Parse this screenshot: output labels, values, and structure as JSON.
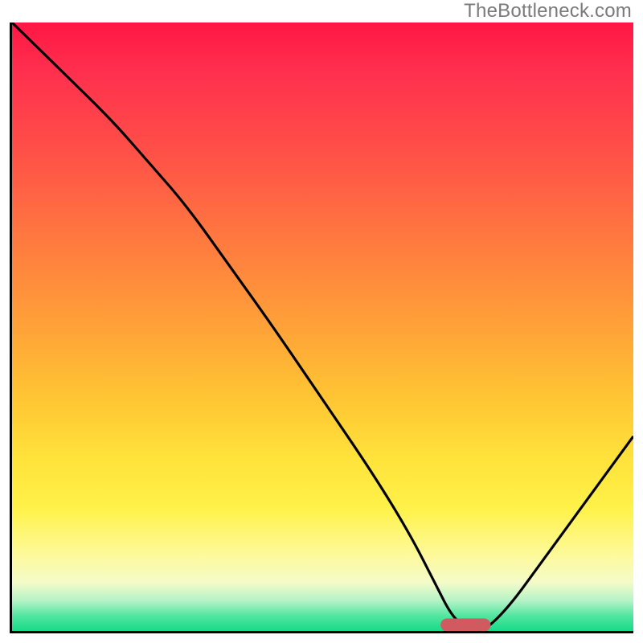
{
  "watermark": "TheBottleneck.com",
  "colors": {
    "axis": "#000000",
    "curve": "#000000",
    "marker": "#d05a5f",
    "gradient_top": "#ff1744",
    "gradient_bottom": "#18da87"
  },
  "chart_data": {
    "type": "line",
    "title": "",
    "xlabel": "",
    "ylabel": "",
    "xlim": [
      0,
      100
    ],
    "ylim": [
      0,
      100
    ],
    "grid": false,
    "legend": false,
    "annotations": [
      "TheBottleneck.com"
    ],
    "marker": {
      "x_start": 70,
      "x_end": 76,
      "y": 1
    },
    "series": [
      {
        "name": "curve",
        "x": [
          0,
          8,
          16,
          22,
          28,
          35,
          42,
          50,
          58,
          64,
          68,
          71,
          74,
          76,
          80,
          85,
          90,
          95,
          100
        ],
        "values": [
          100,
          92,
          84,
          77,
          70,
          60,
          50,
          38,
          26,
          16,
          8,
          2,
          0,
          0,
          4,
          11,
          18,
          25,
          32
        ]
      }
    ]
  }
}
